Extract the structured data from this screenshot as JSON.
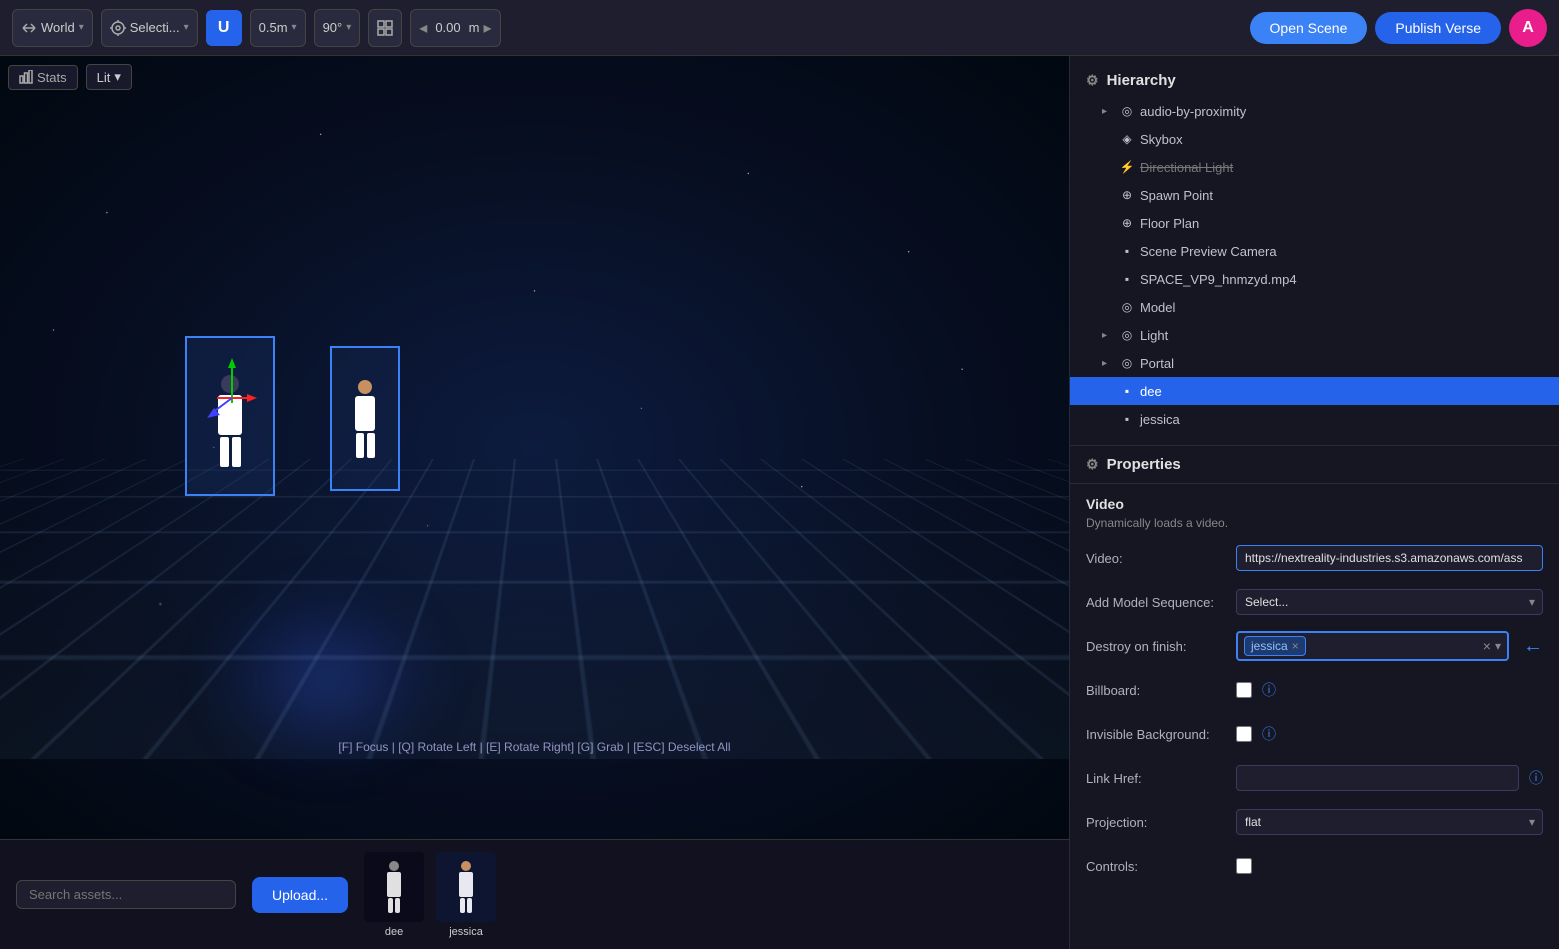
{
  "toolbar": {
    "world_label": "World",
    "selection_label": "Selecti...",
    "ubik_icon": "U",
    "snap_distance": "0.5m",
    "snap_angle": "90°",
    "coord_value": "0.00",
    "coord_unit": "m",
    "open_scene_label": "Open Scene",
    "publish_verse_label": "Publish Verse",
    "avatar_initial": "A"
  },
  "viewport": {
    "stats_label": "Stats",
    "lit_label": "Lit",
    "shortcuts": "[F] Focus | [Q] Rotate Left | [E] Rotate Right] [G] Grab | [ESC] Deselect All"
  },
  "assets": {
    "search_placeholder": "Search assets...",
    "upload_label": "Upload...",
    "items": [
      {
        "name": "dee",
        "type": "dee"
      },
      {
        "name": "jessica",
        "type": "jessica"
      }
    ]
  },
  "hierarchy": {
    "title": "Hierarchy",
    "items": [
      {
        "id": "audio",
        "label": "audio-by-proximity",
        "icon": "◎",
        "indent": 1,
        "expanded": false,
        "strikethrough": false
      },
      {
        "id": "skybox",
        "label": "Skybox",
        "icon": "◈",
        "indent": 1,
        "expanded": false,
        "strikethrough": false
      },
      {
        "id": "dirlight",
        "label": "Directional Light",
        "icon": "⚡",
        "indent": 1,
        "expanded": false,
        "strikethrough": true
      },
      {
        "id": "spawn",
        "label": "Spawn Point",
        "icon": "⊕",
        "indent": 1,
        "expanded": false,
        "strikethrough": false
      },
      {
        "id": "floorplan",
        "label": "Floor Plan",
        "icon": "⊕",
        "indent": 1,
        "expanded": false,
        "strikethrough": false
      },
      {
        "id": "camera",
        "label": "Scene Preview Camera",
        "icon": "▪",
        "indent": 1,
        "expanded": false,
        "strikethrough": false
      },
      {
        "id": "video",
        "label": "SPACE_VP9_hnmzyd.mp4",
        "icon": "▪",
        "indent": 1,
        "expanded": false,
        "strikethrough": false
      },
      {
        "id": "model",
        "label": "Model",
        "icon": "◎",
        "indent": 1,
        "expanded": false,
        "strikethrough": false
      },
      {
        "id": "light",
        "label": "Light",
        "icon": "◎",
        "indent": 1,
        "expanded": true,
        "strikethrough": false
      },
      {
        "id": "portal",
        "label": "Portal",
        "icon": "◎",
        "indent": 1,
        "expanded": true,
        "strikethrough": false
      },
      {
        "id": "dee",
        "label": "dee",
        "icon": "▪",
        "indent": 1,
        "expanded": false,
        "strikethrough": false,
        "selected": true
      },
      {
        "id": "jessica",
        "label": "jessica",
        "icon": "▪",
        "indent": 1,
        "expanded": false,
        "strikethrough": false
      }
    ]
  },
  "properties": {
    "title": "Properties",
    "group_title": "Video",
    "subtitle": "Dynamically loads a video.",
    "fields": {
      "video_label": "Video:",
      "video_value": "https://nextreality-industries.s3.amazonaws.com/ass",
      "add_model_sequence_label": "Add Model Sequence:",
      "add_model_select_placeholder": "Select...",
      "destroy_on_finish_label": "Destroy on finish:",
      "destroy_tag": "jessica",
      "billboard_label": "Billboard:",
      "invisible_background_label": "Invisible Background:",
      "link_href_label": "Link Href:",
      "projection_label": "Projection:",
      "projection_value": "flat",
      "controls_label": "Controls:"
    }
  }
}
